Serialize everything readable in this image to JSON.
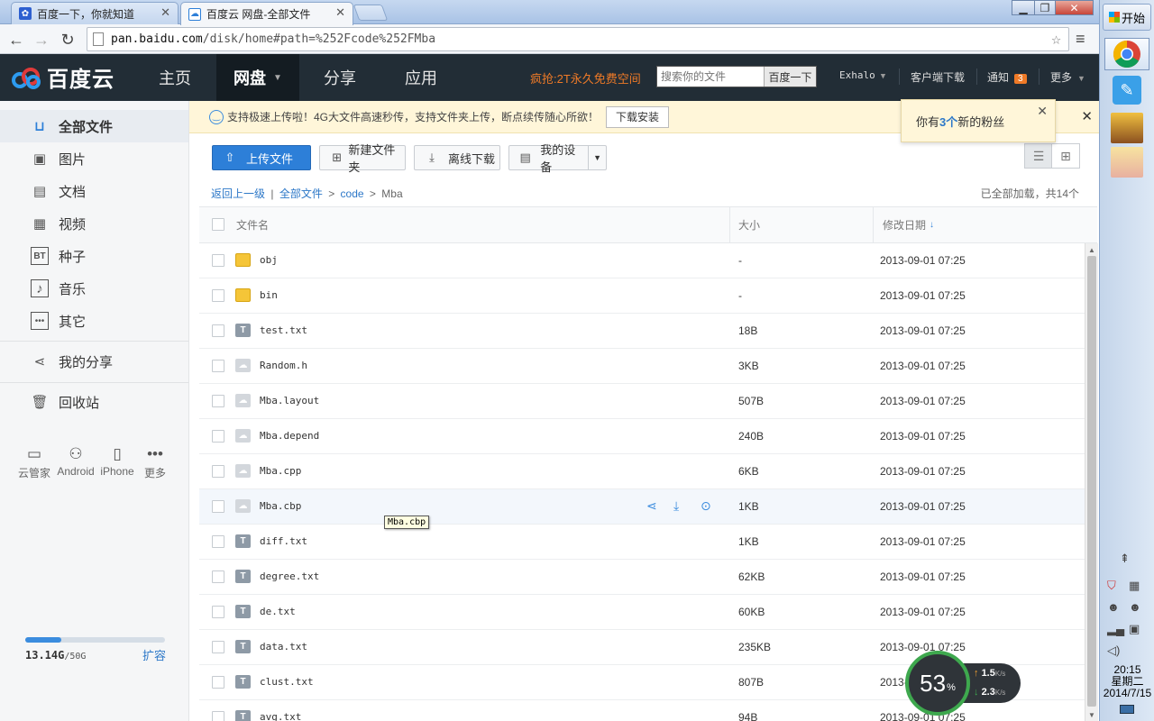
{
  "browser": {
    "tabs": [
      {
        "title": "百度一下，你就知道",
        "active": false
      },
      {
        "title": "百度云 网盘-全部文件",
        "active": true
      }
    ],
    "url": {
      "host": "pan.baidu.com",
      "path": "/disk/home#path=%252Fcode%252FMba"
    }
  },
  "nav": {
    "logo": "百度云",
    "items": [
      "主页",
      "网盘",
      "分享",
      "应用"
    ],
    "promo": "疯抢:2T永久免费空间",
    "search_placeholder": "搜索你的文件",
    "search_button": "百度一下",
    "user": "Exhalo",
    "client_download": "客户端下载",
    "notifications_label": "通知",
    "notifications_count": "3",
    "more": "更多"
  },
  "sidebar": {
    "items": [
      "全部文件",
      "图片",
      "文档",
      "视频",
      "种子",
      "音乐",
      "其它"
    ],
    "share": "我的分享",
    "recycle": "回收站",
    "devices": [
      "云管家",
      "Android",
      "iPhone",
      "更多"
    ],
    "quota_used": "13.14G",
    "quota_total": "/50G",
    "quota_fraction": 0.26,
    "expand": "扩容"
  },
  "notice": {
    "text": "支持极速上传啦！4G大文件高速秒传，支持文件夹上传，断点续传随心所欲！",
    "button": "下载安装"
  },
  "fans_popup": {
    "prefix": "你有",
    "count": "3个",
    "suffix": "新的粉丝"
  },
  "actions": {
    "upload": "上传文件",
    "new_folder": "新建文件夹",
    "offline": "离线下载",
    "devices": "我的设备"
  },
  "breadcrumb": {
    "back": "返回上一级",
    "sep": "|",
    "all": "全部文件",
    "arrow1": ">",
    "code": "code",
    "arrow2": ">",
    "current": "Mba"
  },
  "loaded_status": "已全部加载，共14个",
  "table": {
    "headers": {
      "name": "文件名",
      "size": "大小",
      "date": "修改日期"
    },
    "rows": [
      {
        "name": "obj",
        "size": "-",
        "date": "2013-09-01 07:25",
        "kind": "folder"
      },
      {
        "name": "bin",
        "size": "-",
        "date": "2013-09-01 07:25",
        "kind": "folder"
      },
      {
        "name": "test.txt",
        "size": "18B",
        "date": "2013-09-01 07:25",
        "kind": "txt"
      },
      {
        "name": "Random.h",
        "size": "3KB",
        "date": "2013-09-01 07:25",
        "kind": "other"
      },
      {
        "name": "Mba.layout",
        "size": "507B",
        "date": "2013-09-01 07:25",
        "kind": "other"
      },
      {
        "name": "Mba.depend",
        "size": "240B",
        "date": "2013-09-01 07:25",
        "kind": "other"
      },
      {
        "name": "Mba.cpp",
        "size": "6KB",
        "date": "2013-09-01 07:25",
        "kind": "other"
      },
      {
        "name": "Mba.cbp",
        "size": "1KB",
        "date": "2013-09-01 07:25",
        "kind": "other"
      },
      {
        "name": "diff.txt",
        "size": "1KB",
        "date": "2013-09-01 07:25",
        "kind": "txt"
      },
      {
        "name": "degree.txt",
        "size": "62KB",
        "date": "2013-09-01 07:25",
        "kind": "txt"
      },
      {
        "name": "de.txt",
        "size": "60KB",
        "date": "2013-09-01 07:25",
        "kind": "txt"
      },
      {
        "name": "data.txt",
        "size": "235KB",
        "date": "2013-09-01 07:25",
        "kind": "txt"
      },
      {
        "name": "clust.txt",
        "size": "807B",
        "date": "2013-09-01 07:25",
        "kind": "txt"
      },
      {
        "name": "avg.txt",
        "size": "94B",
        "date": "2013-09-01 07:25",
        "kind": "txt"
      }
    ]
  },
  "tooltip": "Mba.cbp",
  "speed_widget": {
    "percent": "53",
    "unit": "%",
    "up": "1.5",
    "down": "2.3",
    "rate_unit": "K/s"
  },
  "taskbar": {
    "start": "开始",
    "time": "20:15",
    "weekday": "星期二",
    "date": "2014/7/15"
  },
  "colors": {
    "accent": "#2d7fd8",
    "nav_bg": "#222d36",
    "promo": "#ef7a27",
    "notice_bg": "#fff6d9"
  }
}
